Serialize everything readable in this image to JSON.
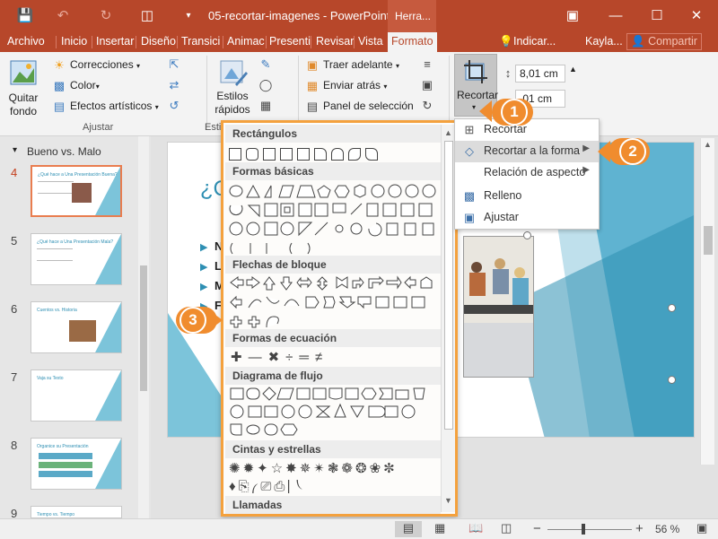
{
  "window": {
    "title": "05-recortar-imagenes - PowerPoint",
    "context_tab": "Herra...",
    "icons": [
      "save-icon",
      "undo-icon",
      "redo-icon",
      "present-icon",
      "customize-icon"
    ],
    "controls": [
      "ribbon-options-icon",
      "minimize-icon",
      "maximize-icon",
      "close-icon"
    ]
  },
  "tabs": [
    {
      "label": "Archivo",
      "selected": false
    },
    {
      "label": "Inicio",
      "selected": false
    },
    {
      "label": "Insertar",
      "selected": false
    },
    {
      "label": "Diseño",
      "selected": false
    },
    {
      "label": "Transici",
      "selected": false
    },
    {
      "label": "Animac",
      "selected": false
    },
    {
      "label": "Presenti",
      "selected": false
    },
    {
      "label": "Revisar",
      "selected": false
    },
    {
      "label": "Vista",
      "selected": false
    },
    {
      "label": "Formato",
      "selected": true
    }
  ],
  "tell_me": "Indicar...",
  "user": "Kayla...",
  "share": "Compartir",
  "ribbon": {
    "quitar_fondo": "Quitar fondo",
    "correcciones": "Correcciones",
    "color": "Color",
    "efectos": "Efectos artísticos",
    "ajustar_label": "Ajustar",
    "estilos": "Estilos rápidos",
    "estil_label": "Estil",
    "traer": "Traer adelante",
    "enviar": "Enviar atrás",
    "panel": "Panel de selección",
    "recortar": "Recortar",
    "height_value": "8,01 cm",
    "width_value": ",01 cm"
  },
  "slides_pane": {
    "title": "Bueno vs. Malo",
    "slides": [
      {
        "num": "4",
        "active": true,
        "caption": "¿Qué hace a Una Presentación Buena?"
      },
      {
        "num": "5",
        "active": false,
        "caption": "¿Qué hace a Una Presentación Mala?"
      },
      {
        "num": "6",
        "active": false,
        "caption": "Cuentos vs. Historia"
      },
      {
        "num": "7",
        "active": false,
        "caption": "Vaja su Texto"
      },
      {
        "num": "8",
        "active": false,
        "caption": "Organice su Presentación"
      },
      {
        "num": "9",
        "active": false,
        "caption": "Tiempo vs. Tiempo"
      }
    ]
  },
  "slide": {
    "title_partial": "¿Q",
    "bullets": [
      "N",
      "L",
      "M",
      "F"
    ]
  },
  "gallery": {
    "categories": [
      "Rectángulos",
      "Formas básicas",
      "Flechas de bloque",
      "Formas de ecuación",
      "Diagrama de flujo",
      "Cintas y estrellas",
      "Llamadas"
    ]
  },
  "crop_menu": {
    "items": [
      {
        "label": "Recortar",
        "icon": "crop-icon",
        "submenu": false,
        "highlighted": false
      },
      {
        "label": "Recortar a la forma",
        "icon": "shape-crop-icon",
        "submenu": true,
        "highlighted": true
      },
      {
        "label": "Relación de aspecto",
        "icon": "",
        "submenu": true,
        "highlighted": false
      },
      {
        "label": "Relleno",
        "icon": "fill-icon",
        "submenu": false,
        "highlighted": false
      },
      {
        "label": "Ajustar",
        "icon": "fit-icon",
        "submenu": false,
        "highlighted": false
      }
    ]
  },
  "callouts": [
    "1",
    "2",
    "3"
  ],
  "status": {
    "zoom": "56 %",
    "zoom_minus": "−",
    "zoom_plus": "+"
  },
  "colors": {
    "accent": "#b7472a",
    "callout": "#f08c2e",
    "gallery_border": "#f4a13d",
    "slide_teal": "#2e8fb3"
  }
}
